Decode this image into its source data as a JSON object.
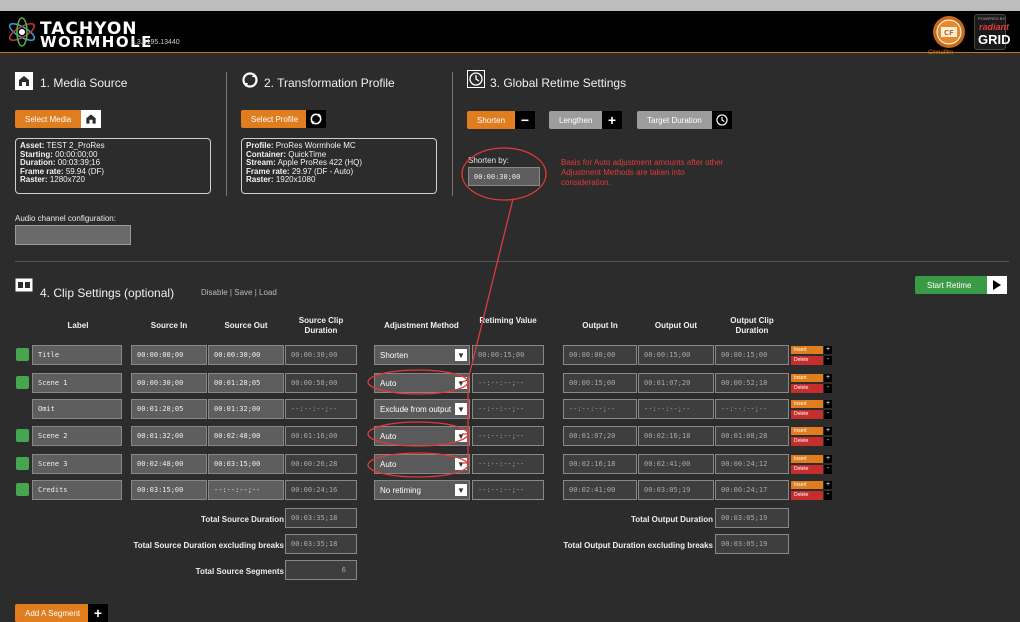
{
  "header": {
    "brand_line1": "TACHYON",
    "brand_line2": "WORMHOLE",
    "version": "2.3.6195.13440",
    "partner1_text": "Cinnafilm",
    "partner2_small": "POWERED BY",
    "partner2_line1": "radiant",
    "partner2_line2": "GRID"
  },
  "media_source": {
    "title": "1. Media Source",
    "button": "Select Media",
    "info": {
      "asset_label": "Asset:",
      "asset_value": "TEST 2_ProRes",
      "starting_label": "Starting:",
      "starting_value": "00:00:00;00",
      "duration_label": "Duration:",
      "duration_value": "00:03:39;16",
      "framerate_label": "Frame rate:",
      "framerate_value": "59.94 (DF)",
      "raster_label": "Raster:",
      "raster_value": "1280x720"
    },
    "audio_label": "Audio channel configuration:",
    "audio_value": ""
  },
  "transformation_profile": {
    "title": "2. Transformation Profile",
    "button": "Select Profile",
    "info": {
      "profile_label": "Profile:",
      "profile_value": "ProRes Wormhole MC",
      "container_label": "Container:",
      "container_value": "QuickTime",
      "stream_label": "Stream:",
      "stream_value": "Apple ProRes 422 (HQ)",
      "framerate_label": "Frame rate:",
      "framerate_value": "29.97 (DF - Auto)",
      "raster_label": "Raster:",
      "raster_value": "1920x1080"
    }
  },
  "global_retime": {
    "title": "3. Global Retime Settings",
    "shorten_label": "Shorten",
    "lengthen_label": "Lengthen",
    "target_label": "Target Duration",
    "shorten_by_label": "Shorten by:",
    "shorten_by_value": "00:00:30;00",
    "annotation": "Basis for Auto adjustment amounts after other Adjustment Methods are taken into consideration."
  },
  "clip_settings": {
    "title": "4. Clip Settings (optional)",
    "disable": "Disable",
    "save": "Save",
    "load": "Load",
    "sep": "|",
    "start_button": "Start Retime",
    "columns": {
      "label": "Label",
      "source_in": "Source In",
      "source_out": "Source Out",
      "source_clip_duration": "Source Clip Duration",
      "adjustment_method": "Adjustment Method",
      "retiming_value": "Retiming Value",
      "output_in": "Output In",
      "output_out": "Output Out",
      "output_clip_duration": "Output Clip Duration"
    },
    "rows": [
      {
        "label": "Title",
        "src_in": "00:00:00;00",
        "src_out": "00:00:30;00",
        "src_dur": "00:00:30;00",
        "method": "Shorten",
        "retime": "00:00:15;00",
        "out_in": "00:00:00;00",
        "out_out": "00:00:15;00",
        "out_dur": "00:00:15;00",
        "checked": true
      },
      {
        "label": "Scene 1",
        "src_in": "00:00:30;00",
        "src_out": "00:01:28;05",
        "src_dur": "00:00:58;00",
        "method": "Auto",
        "retime": "--:--:--;--",
        "out_in": "00:00:15;00",
        "out_out": "00:01:07;20",
        "out_dur": "00:00:52;18",
        "checked": true
      },
      {
        "label": "Omit",
        "src_in": "00:01:28;05",
        "src_out": "00:01:32;00",
        "src_dur": "--:--:--;--",
        "method": "Exclude from output",
        "retime": "--:--:--;--",
        "out_in": "--:--:--;--",
        "out_out": "--:--:--;--",
        "out_dur": "--:--:--;--",
        "checked": false
      },
      {
        "label": "Scene 2",
        "src_in": "00:01:32;00",
        "src_out": "00:02:48;00",
        "src_dur": "00:01:16;00",
        "method": "Auto",
        "retime": "--:--:--;--",
        "out_in": "00:01:07;20",
        "out_out": "00:02:16;18",
        "out_dur": "00:01:08;28",
        "checked": true
      },
      {
        "label": "Scene 3",
        "src_in": "00:02:48;00",
        "src_out": "00:03:15;00",
        "src_dur": "00:00:26;28",
        "method": "Auto",
        "retime": "--:--:--;--",
        "out_in": "00:02:16;18",
        "out_out": "00:02:41;00",
        "out_dur": "00:00:24;12",
        "checked": true
      },
      {
        "label": "Credits",
        "src_in": "00:03:15;00",
        "src_out": "--:--:--;--",
        "src_dur": "00:00:24;16",
        "method": "No retiming",
        "retime": "--:--:--;--",
        "out_in": "00:02:41;00",
        "out_out": "00:03:05;19",
        "out_dur": "00:00:24;17",
        "checked": true
      }
    ],
    "insert_label": "Insert",
    "delete_label": "Delete",
    "totals": {
      "total_source_duration_label": "Total Source Duration",
      "total_source_duration": "00:03:35;18",
      "total_source_excl_label": "Total Source Duration excluding breaks",
      "total_source_excl": "00:03:35;18",
      "total_source_segments_label": "Total Source Segments",
      "total_source_segments": "6",
      "total_output_duration_label": "Total Output Duration",
      "total_output_duration": "00:03:05;19",
      "total_output_excl_label": "Total Output Duration excluding breaks",
      "total_output_excl": "00:03:05;19"
    },
    "add_segment": "Add A Segment"
  },
  "colors": {
    "orange": "#e07d1e",
    "green": "#3a9b46",
    "red_annotation": "#e03a3a",
    "background": "#2c2c2c"
  }
}
